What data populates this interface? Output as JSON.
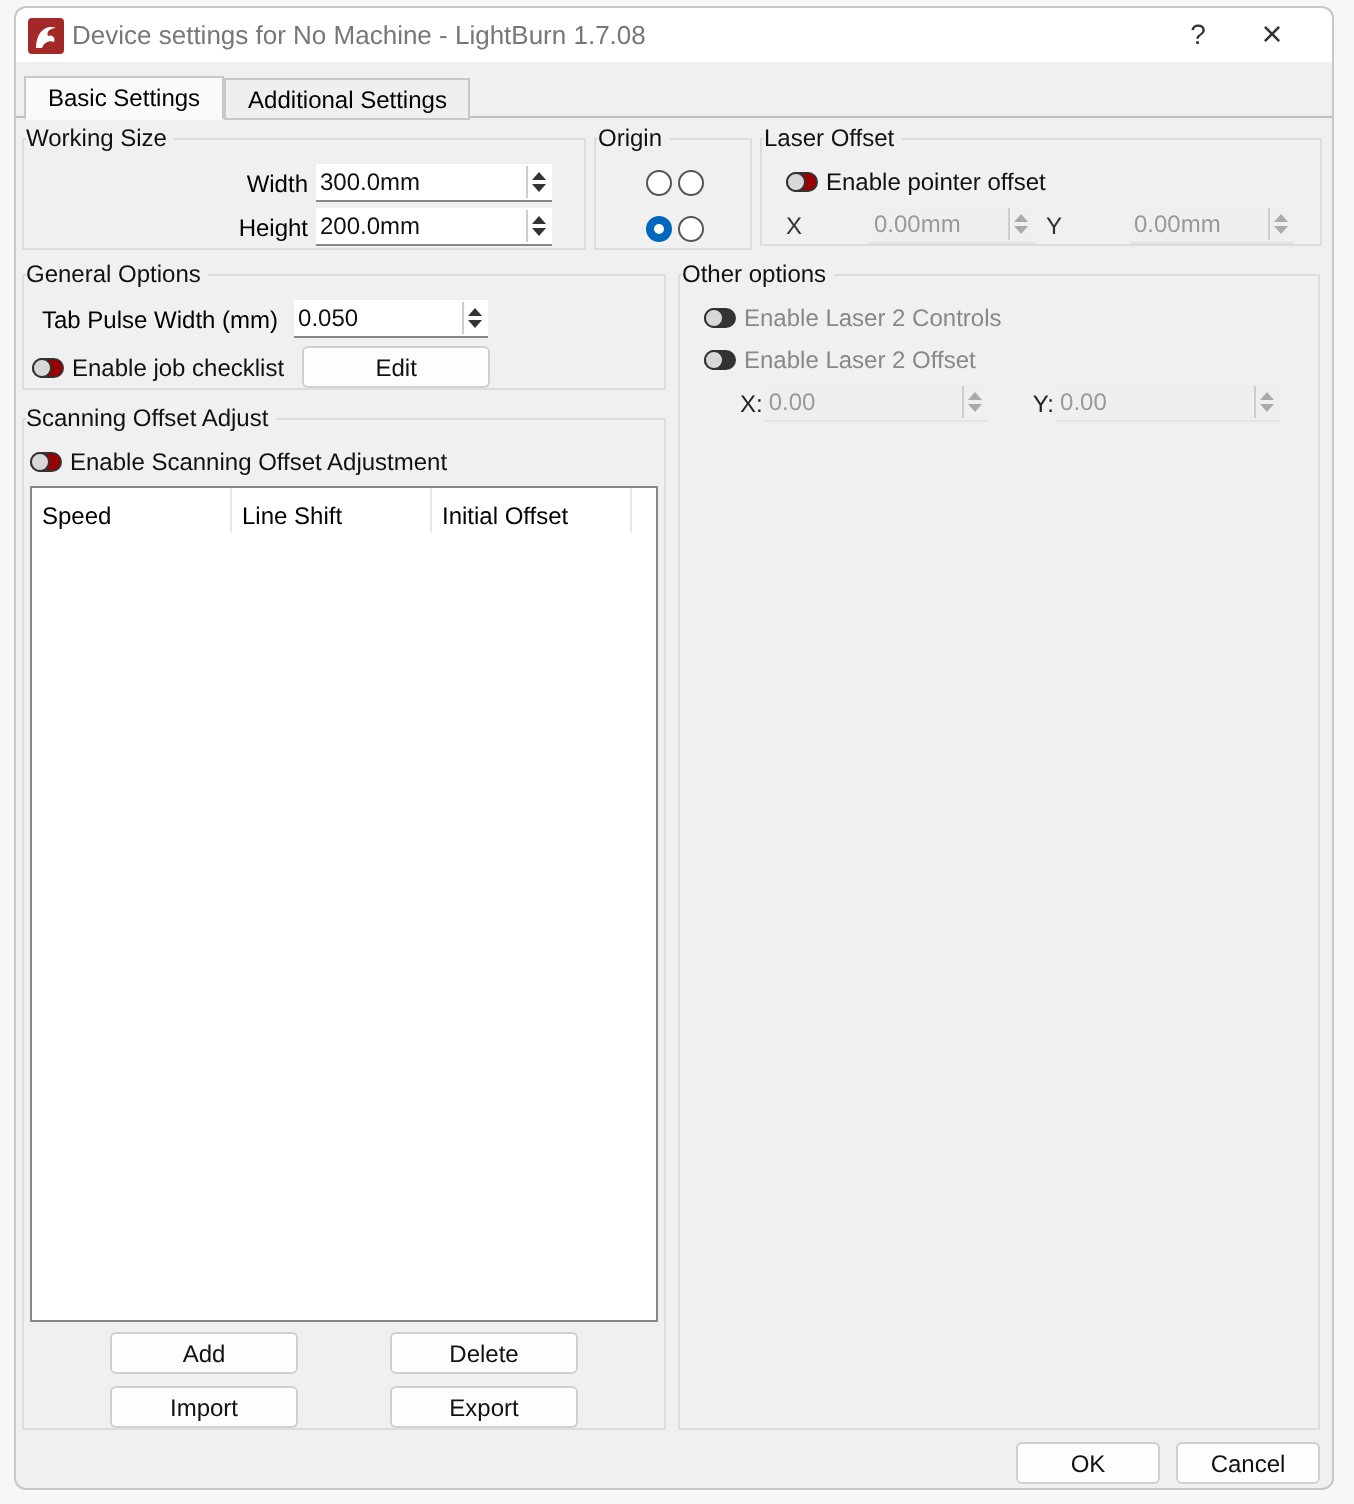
{
  "window": {
    "title": "Device settings for No Machine - LightBurn 1.7.08",
    "help": "?",
    "close": "×"
  },
  "tabs": [
    {
      "label": "Basic Settings",
      "selected": true
    },
    {
      "label": "Additional Settings",
      "selected": false
    }
  ],
  "working_size": {
    "title": "Working Size",
    "fields": [
      {
        "label": "Width",
        "value": "300.0mm"
      },
      {
        "label": "Height",
        "value": "200.0mm"
      }
    ]
  },
  "origin": {
    "title": "Origin",
    "options": [
      {
        "selected": false
      },
      {
        "selected": false
      },
      {
        "selected": true
      },
      {
        "selected": false
      }
    ]
  },
  "laser_offset": {
    "title": "Laser Offset",
    "toggle": {
      "label": "Enable pointer offset",
      "checked": false,
      "disabled": false
    },
    "fields": [
      {
        "label": "X",
        "value": "0.00mm",
        "disabled": true
      },
      {
        "label": "Y",
        "value": "0.00mm",
        "disabled": true
      }
    ]
  },
  "general_options": {
    "title": "General Options",
    "tab_pulse": {
      "label": "Tab Pulse Width (mm)",
      "value": "0.050"
    },
    "toggle": {
      "label": "Enable job checklist",
      "checked": false,
      "disabled": false
    },
    "edit_button": "Edit"
  },
  "other_options": {
    "title": "Other options",
    "toggles": [
      {
        "label": "Enable Laser 2 Controls",
        "checked": false,
        "disabled": true
      },
      {
        "label": "Enable Laser 2 Offset",
        "checked": false,
        "disabled": true
      }
    ],
    "fields": [
      {
        "label": "X:",
        "value": "0.00",
        "disabled": true
      },
      {
        "label": "Y:",
        "value": "0.00",
        "disabled": true
      }
    ]
  },
  "scanning": {
    "title": "Scanning Offset Adjust",
    "toggle": {
      "label": "Enable Scanning Offset Adjustment",
      "checked": false,
      "disabled": false
    },
    "table": {
      "columns": [
        "Speed",
        "Line Shift",
        "Initial Offset"
      ]
    },
    "buttons": [
      "Add",
      "Delete",
      "Import",
      "Export"
    ]
  },
  "buttons": [
    "OK",
    "Cancel"
  ]
}
